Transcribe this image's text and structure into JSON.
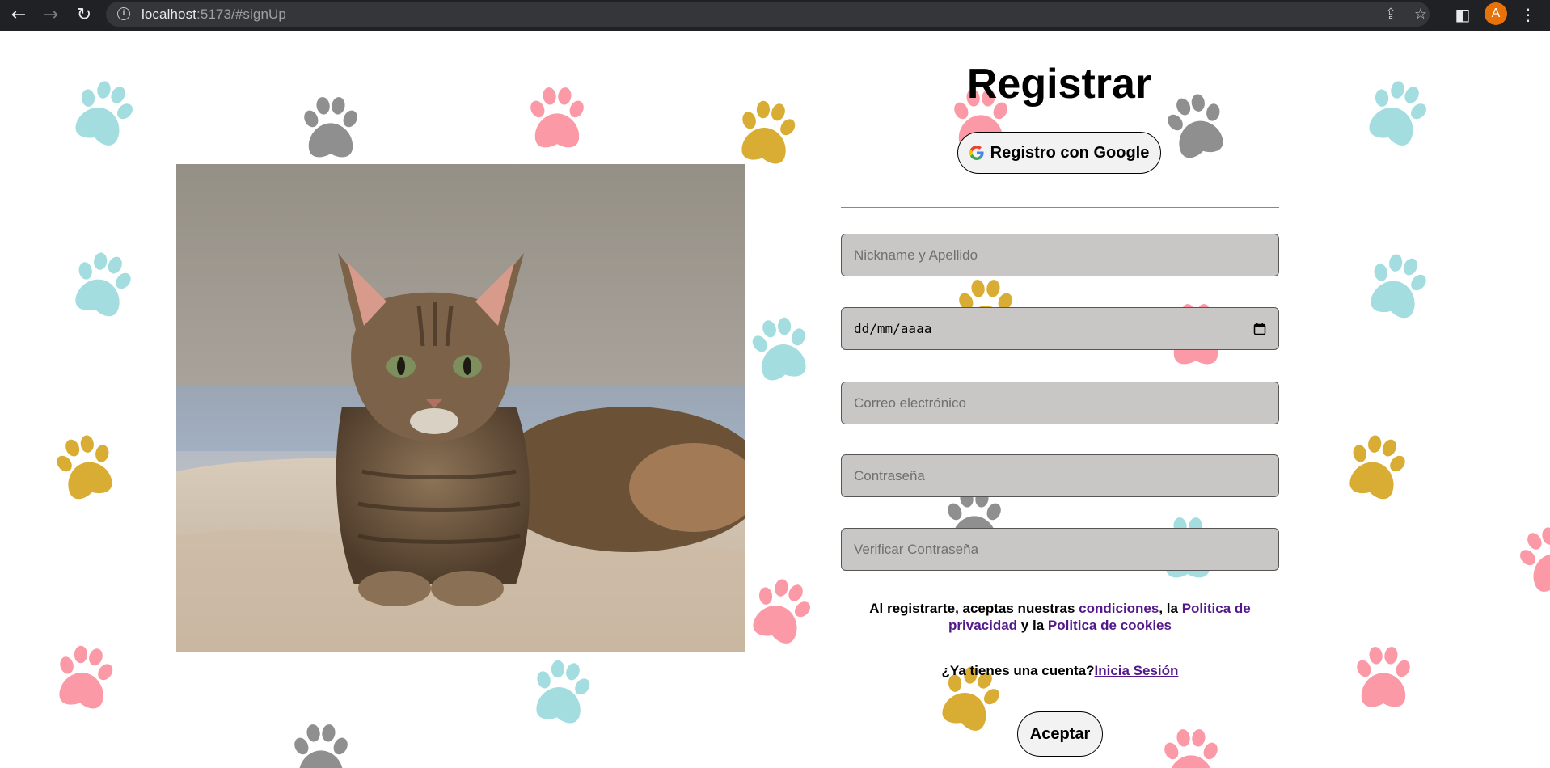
{
  "browser": {
    "back_icon": "←",
    "forward_icon": "→",
    "reload_icon": "↻",
    "url_host": "localhost",
    "url_path": ":5173/#signUp",
    "share_icon": "⇪",
    "star_icon": "☆",
    "sidepanel_icon": "◧",
    "profile_initial": "A",
    "menu_icon": "⋮"
  },
  "signup": {
    "title": "Registrar",
    "google_button": "Registro con Google",
    "fields": {
      "name_placeholder": "Nickname y Apellido",
      "date_placeholder": "dd/mm/aaaa",
      "email_placeholder": "Correo electrónico",
      "password_placeholder": "Contraseña",
      "confirm_placeholder": "Verificar Contraseña"
    },
    "terms": {
      "prefix": "Al registrarte, aceptas nuestras ",
      "conditions_link": "condiciones",
      "middle1": ", la ",
      "privacy_link": "Politica de privacidad",
      "middle2": " y la ",
      "cookies_link": "Politica de cookies"
    },
    "have_account_text": "¿Ya tienes una cuenta?",
    "login_link": "Inicia Sesión",
    "accept_button": "Aceptar"
  },
  "colors": {
    "paw_teal": "#a3dde0",
    "paw_pink": "#fb9aa6",
    "paw_gray": "#8f8f8f",
    "paw_gold": "#d9ac33",
    "link": "#52188c",
    "input_bg": "#c9c7c6"
  }
}
